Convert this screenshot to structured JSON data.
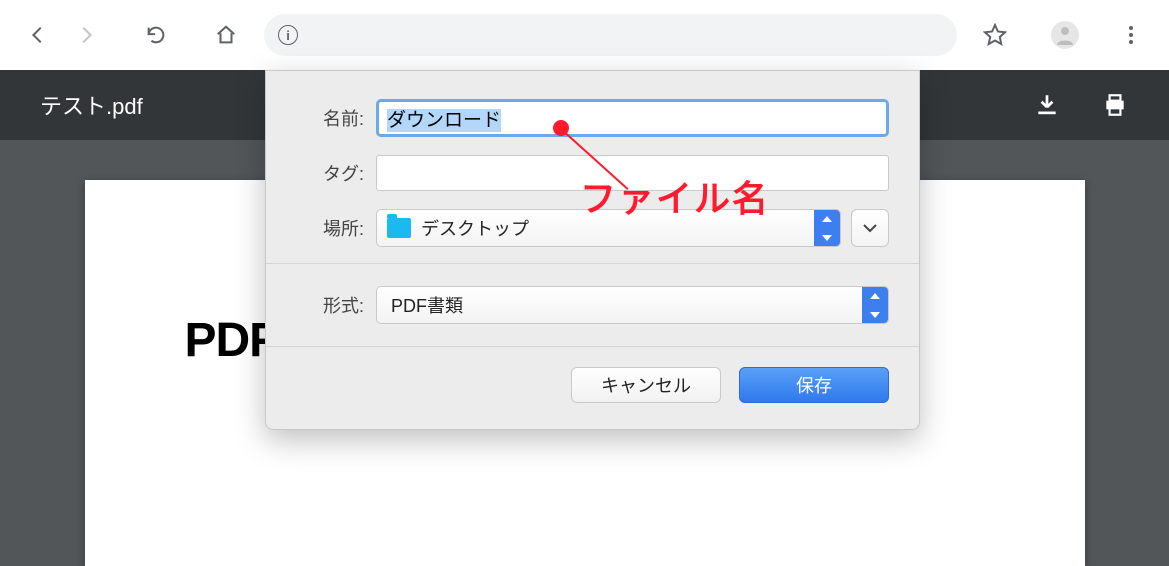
{
  "browser": {
    "back_icon": "back-icon",
    "forward_icon": "forward-icon",
    "reload_icon": "reload-icon",
    "home_icon": "home-icon",
    "info_char": "i"
  },
  "pdf": {
    "filename": "テスト.pdf",
    "heading": "PDFフ"
  },
  "dialog": {
    "labels": {
      "name": "名前:",
      "tags": "タグ:",
      "location": "場所:",
      "format": "形式:"
    },
    "name_value": "ダウンロード",
    "tags_value": "",
    "location_value": "デスクトップ",
    "format_value": "PDF書類",
    "buttons": {
      "cancel": "キャンセル",
      "save": "保存"
    }
  },
  "annotation": {
    "text": "ファイル名"
  }
}
